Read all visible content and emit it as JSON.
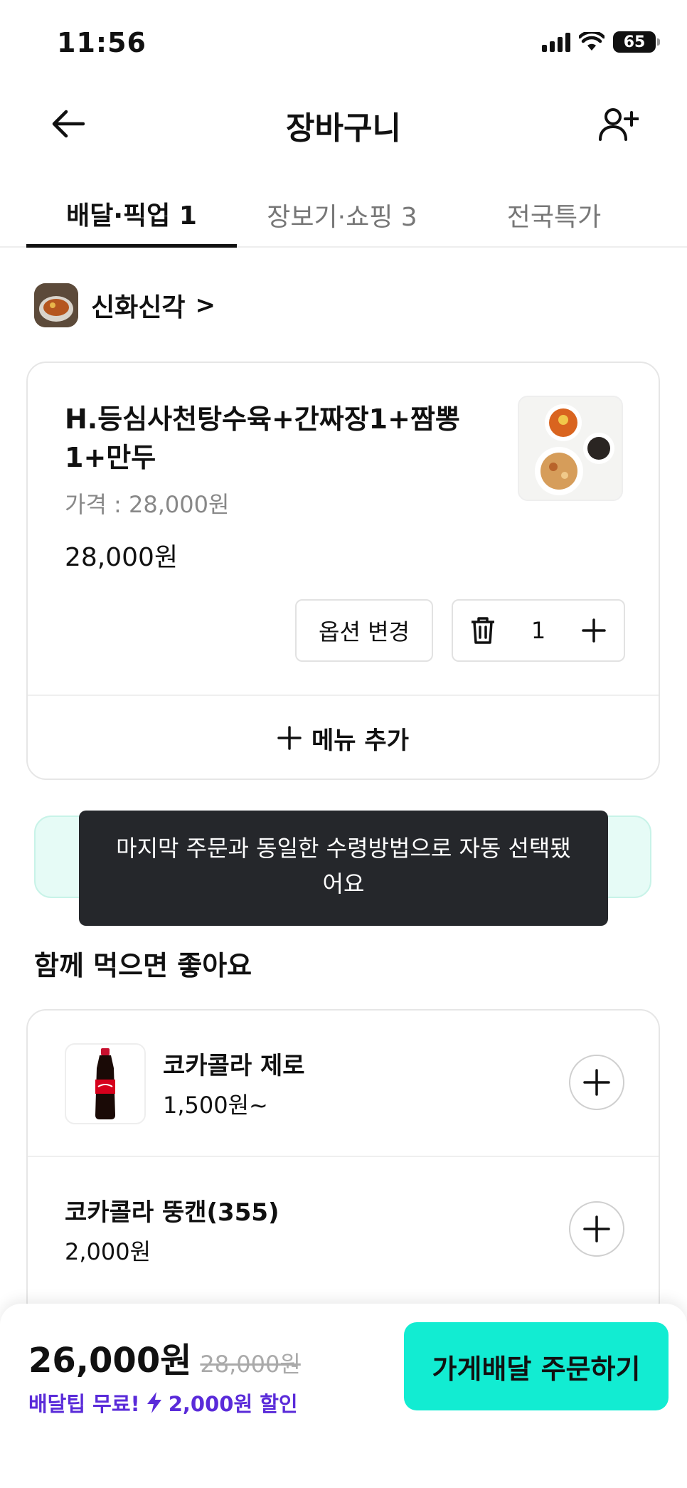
{
  "status_bar": {
    "time": "11:56",
    "battery": "65"
  },
  "header": {
    "title": "장바구니"
  },
  "tabs": [
    {
      "label": "배달·픽업 1",
      "active": true
    },
    {
      "label": "장보기·쇼핑 3",
      "active": false
    },
    {
      "label": "전국특가",
      "active": false
    }
  ],
  "store": {
    "name": "신화신각",
    "chevron": ">"
  },
  "cart_item": {
    "name": "H.등심사천탕수육+간짜장1+짬뽕1+만두",
    "price_label": "가격 : 28,000원",
    "total": "28,000원",
    "option_button": "옵션 변경",
    "quantity": "1"
  },
  "add_menu_label": "메뉴 추가",
  "toast": {
    "message": "마지막 주문과 동일한 수령방법으로 자동 선택됐어요"
  },
  "recommend": {
    "title": "함께 먹으면 좋아요",
    "items": [
      {
        "name": "코카콜라 제로",
        "price": "1,500원~"
      },
      {
        "name": "코카콜라 뚱캔(355)",
        "price": "2,000원"
      }
    ]
  },
  "bottom": {
    "total_now": "26,000원",
    "total_old": "28,000원",
    "free_delivery": "배달팁 무료!",
    "discount": "2,000원 할인",
    "order_button": "가게배달 주문하기"
  },
  "colors": {
    "accent": "#12ecd2",
    "promo": "#5a2bd9",
    "toast_bg": "#25272b"
  }
}
